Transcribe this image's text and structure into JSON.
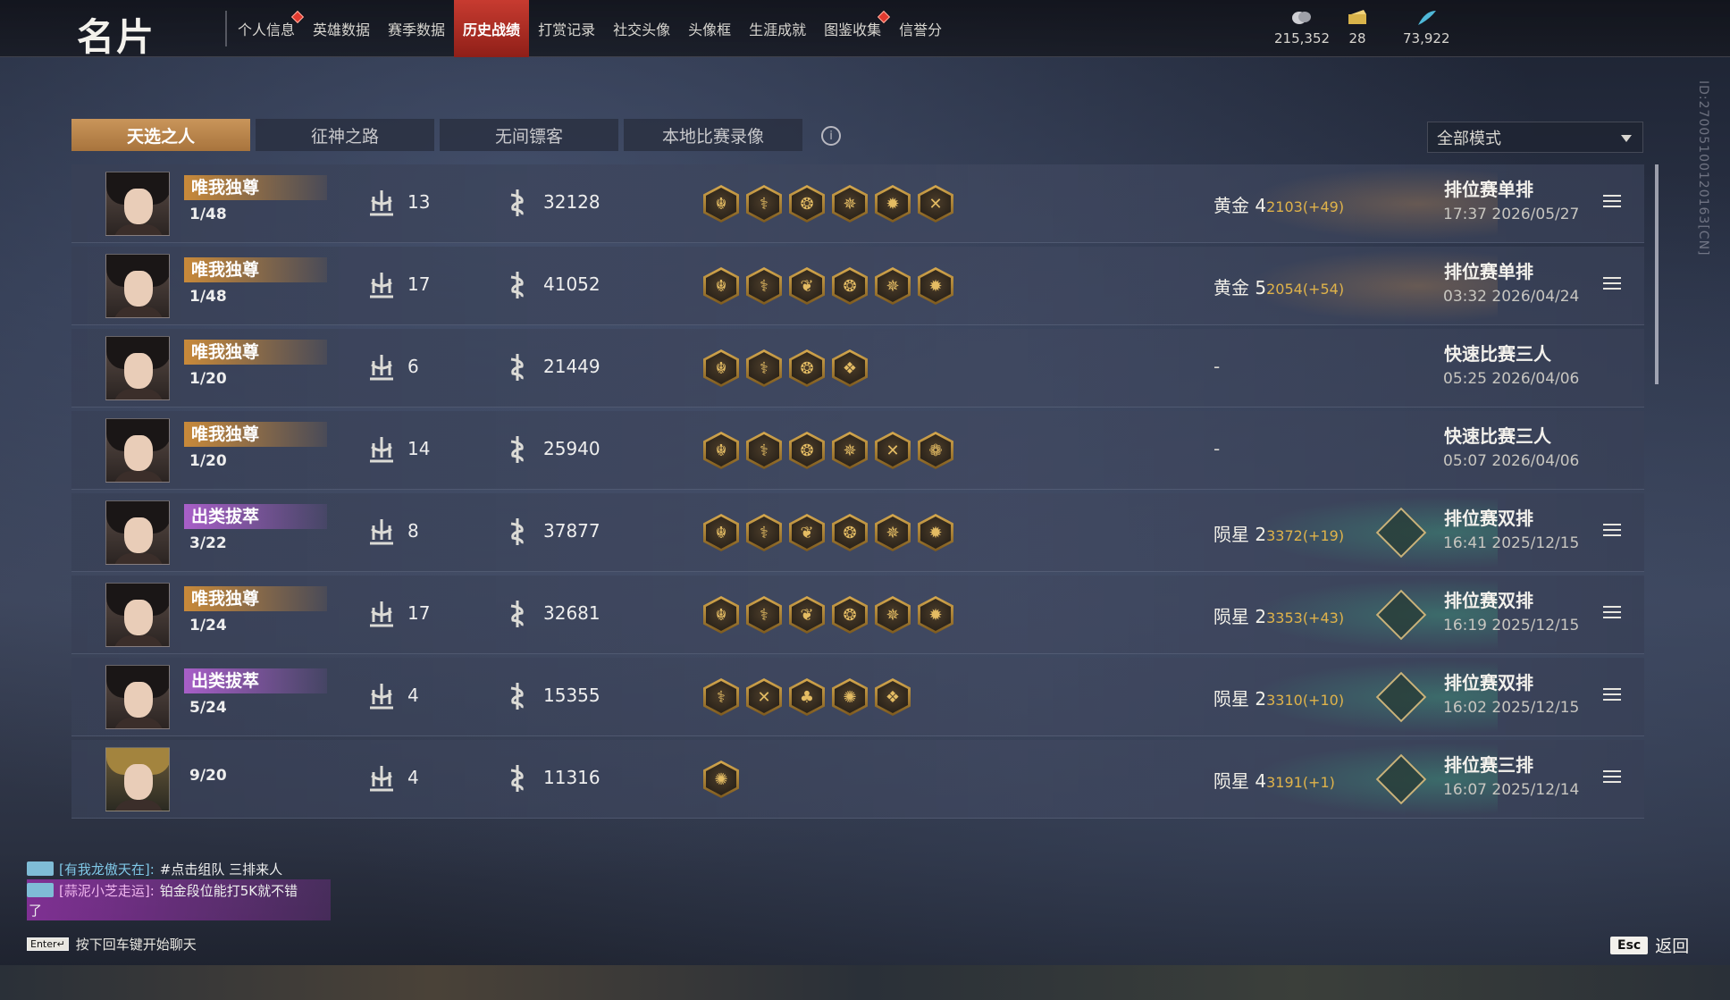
{
  "header": {
    "title": "名片",
    "tabs": [
      {
        "label": "个人信息",
        "dot": true
      },
      {
        "label": "英雄数据",
        "dot": false
      },
      {
        "label": "赛季数据",
        "dot": false
      },
      {
        "label": "历史战绩",
        "dot": false,
        "active": true
      },
      {
        "label": "打赏记录",
        "dot": false
      },
      {
        "label": "社交头像",
        "dot": false
      },
      {
        "label": "头像框",
        "dot": false
      },
      {
        "label": "生涯成就",
        "dot": false
      },
      {
        "label": "图鉴收集",
        "dot": true
      },
      {
        "label": "信誉分",
        "dot": false
      }
    ],
    "currencies": [
      {
        "icon": "coin-icon",
        "value": "215,352"
      },
      {
        "icon": "ticket-icon",
        "value": "28"
      },
      {
        "icon": "feather-icon",
        "value": "73,922"
      }
    ]
  },
  "user_id": "ID:2700510012016​3[CN]",
  "subtabs": [
    "天选之人",
    "征神之路",
    "无间镖客",
    "本地比赛录像"
  ],
  "active_subtab": 0,
  "mode_filter": "全部模式",
  "matches": [
    {
      "badge": "唯我独尊",
      "badge_color": "gold",
      "rank": "1/48",
      "kills": "13",
      "damage": "32128",
      "medals": [
        "☬",
        "⚕",
        "❂",
        "✵",
        "✹",
        "✕"
      ],
      "tier": "黄金 4",
      "pts": "2103(+49)",
      "tier_style": "gold",
      "mode": "排位赛单排",
      "time": "17:37  2026/05/27",
      "menu": true
    },
    {
      "badge": "唯我独尊",
      "badge_color": "gold",
      "rank": "1/48",
      "kills": "17",
      "damage": "41052",
      "medals": [
        "☬",
        "⚕",
        "❦",
        "❂",
        "✵",
        "✹"
      ],
      "tier": "黄金 5",
      "pts": "2054(+54)",
      "tier_style": "gold",
      "mode": "排位赛单排",
      "time": "03:32  2026/04/24",
      "menu": true
    },
    {
      "badge": "唯我独尊",
      "badge_color": "gold",
      "rank": "1/20",
      "kills": "6",
      "damage": "21449",
      "medals": [
        "☬",
        "⚕",
        "❂",
        "❖"
      ],
      "tier": "-",
      "pts": "",
      "tier_style": "none",
      "mode": "快速比赛三人",
      "time": "05:25  2026/04/06",
      "menu": false
    },
    {
      "badge": "唯我独尊",
      "badge_color": "gold",
      "rank": "1/20",
      "kills": "14",
      "damage": "25940",
      "medals": [
        "☬",
        "⚕",
        "❂",
        "✵",
        "✕",
        "❁"
      ],
      "tier": "-",
      "pts": "",
      "tier_style": "none",
      "mode": "快速比赛三人",
      "time": "05:07  2026/04/06",
      "menu": false
    },
    {
      "badge": "出类拔萃",
      "badge_color": "purple",
      "rank": "3/22",
      "kills": "8",
      "damage": "37877",
      "medals": [
        "☬",
        "⚕",
        "❦",
        "❂",
        "✵",
        "✹"
      ],
      "tier": "陨星 2",
      "pts": "3372(+19)",
      "tier_style": "meteor",
      "mode": "排位赛双排",
      "time": "16:41  2025/12/15",
      "menu": true
    },
    {
      "badge": "唯我独尊",
      "badge_color": "gold",
      "rank": "1/24",
      "kills": "17",
      "damage": "32681",
      "medals": [
        "☬",
        "⚕",
        "❦",
        "❂",
        "✵",
        "✹"
      ],
      "tier": "陨星 2",
      "pts": "3353(+43)",
      "tier_style": "meteor",
      "mode": "排位赛双排",
      "time": "16:19  2025/12/15",
      "menu": true
    },
    {
      "badge": "出类拔萃",
      "badge_color": "purple",
      "rank": "5/24",
      "kills": "4",
      "damage": "15355",
      "medals": [
        "⚕",
        "✕",
        "♣",
        "✺",
        "❖"
      ],
      "tier": "陨星 2",
      "pts": "3310(+10)",
      "tier_style": "meteor",
      "mode": "排位赛双排",
      "time": "16:02  2025/12/15",
      "menu": true
    },
    {
      "badge": "",
      "badge_color": "none",
      "rank": "9/20",
      "kills": "4",
      "damage": "11316",
      "medals": [
        "✺"
      ],
      "tier": "陨星 4",
      "pts": "3191(+1)",
      "tier_style": "meteor",
      "mode": "排位赛三排",
      "time": "16:07  2025/12/14",
      "menu": true
    }
  ],
  "chat": [
    {
      "who": "[有我龙傲天在]:",
      "msg": "#点击组队 三排来人",
      "highlight": false
    },
    {
      "who": "[蒜泥小芝走运]:",
      "msg": "铂金段位能打5K就不错",
      "cont": "了",
      "highlight": true
    }
  ],
  "chat_hint": "按下回车键开始聊天",
  "enter_key": "Enter↵",
  "esc_key": "Esc",
  "back_label": "返回"
}
